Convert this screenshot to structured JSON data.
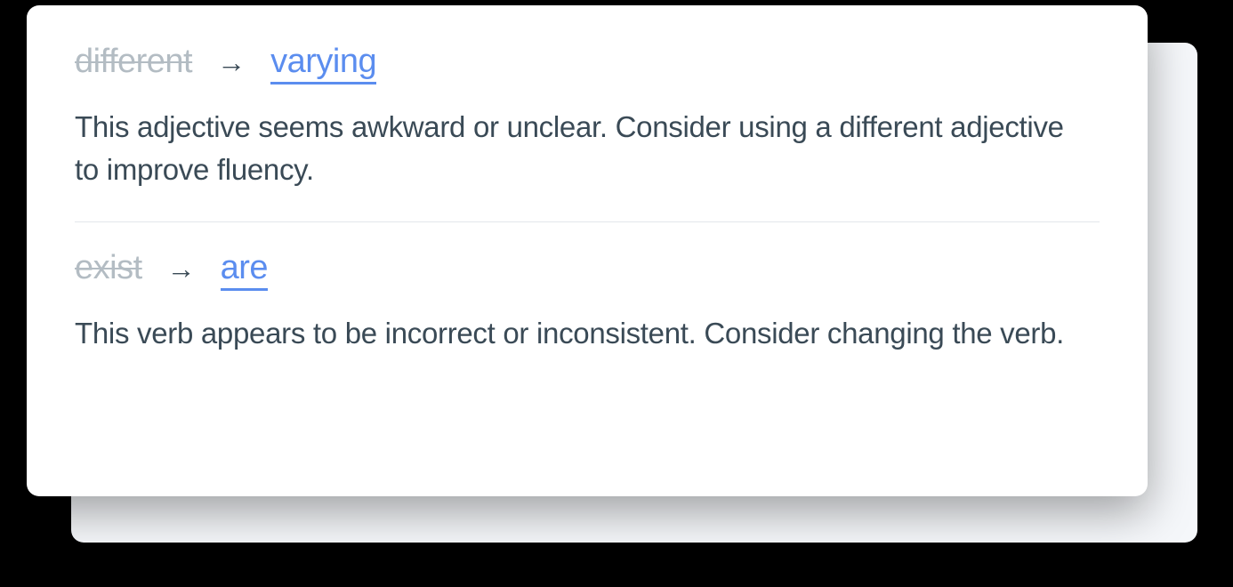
{
  "suggestions": [
    {
      "original": "different",
      "replacement": "varying",
      "explanation": "This adjective seems awkward or unclear. Consider using a different adjective to improve fluency."
    },
    {
      "original": "exist",
      "replacement": "are",
      "explanation": "This verb appears to be incorrect or inconsistent. Consider changing the verb."
    }
  ],
  "arrow_glyph": "→"
}
